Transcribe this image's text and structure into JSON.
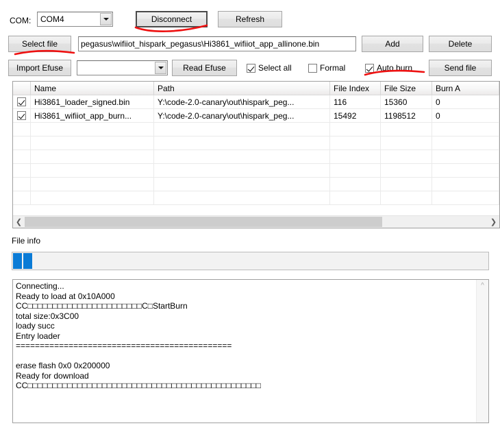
{
  "toolbar": {
    "com_label": "COM:",
    "com_value": "COM4",
    "disconnect_label": "Disconnect",
    "refresh_label": "Refresh",
    "select_file_label": "Select file",
    "file_path_value": "pegasus\\wifiiot_hispark_pegasus\\Hi3861_wifiiot_app_allinone.bin",
    "add_label": "Add",
    "delete_label": "Delete",
    "import_efuse_label": "Import Efuse",
    "efuse_combo_value": "",
    "read_efuse_label": "Read Efuse",
    "select_all_label": "Select all",
    "select_all_checked": true,
    "formal_label": "Formal",
    "formal_checked": false,
    "auto_burn_label": "Auto burn",
    "auto_burn_checked": true,
    "send_file_label": "Send file"
  },
  "table": {
    "columns": [
      "",
      "Name",
      "Path",
      "File Index",
      "File Size",
      "Burn A"
    ],
    "rows": [
      {
        "checked": true,
        "name": "Hi3861_loader_signed.bin",
        "path": "Y:\\code-2.0-canary\\out\\hispark_peg...",
        "file_index": "116",
        "file_size": "15360",
        "burn_addr": "0"
      },
      {
        "checked": true,
        "name": "Hi3861_wifiiot_app_burn...",
        "path": "Y:\\code-2.0-canary\\out\\hispark_peg...",
        "file_index": "15492",
        "file_size": "1198512",
        "burn_addr": "0"
      }
    ],
    "empty_row_count": 6,
    "hscroll_left_icon": "chevron-left",
    "hscroll_right_icon": "chevron-right"
  },
  "file_info": {
    "label": "File info",
    "progress_blocks": 2,
    "progress_color": "#0a7bd6"
  },
  "log": {
    "scroll_up_icon": "chevron-up",
    "lines": [
      "Connecting...",
      "Ready to load at 0x10A000",
      "CC□□□□□□□□□□□□□□□□□□□□□□□C□StartBurn",
      "total size:0x3C00",
      "loady succ",
      "Entry loader",
      "=============================================",
      "",
      "erase flash 0x0 0x200000",
      "Ready for download",
      "CC□□□□□□□□□□□□□□□□□□□□□□□□□□□□□□□□□□□□□□□□□□□□□□□"
    ]
  },
  "annotations": {
    "color": "#ee1111",
    "marks": [
      "underline-disconnect",
      "underline-select-file",
      "underline-auto-burn"
    ]
  }
}
